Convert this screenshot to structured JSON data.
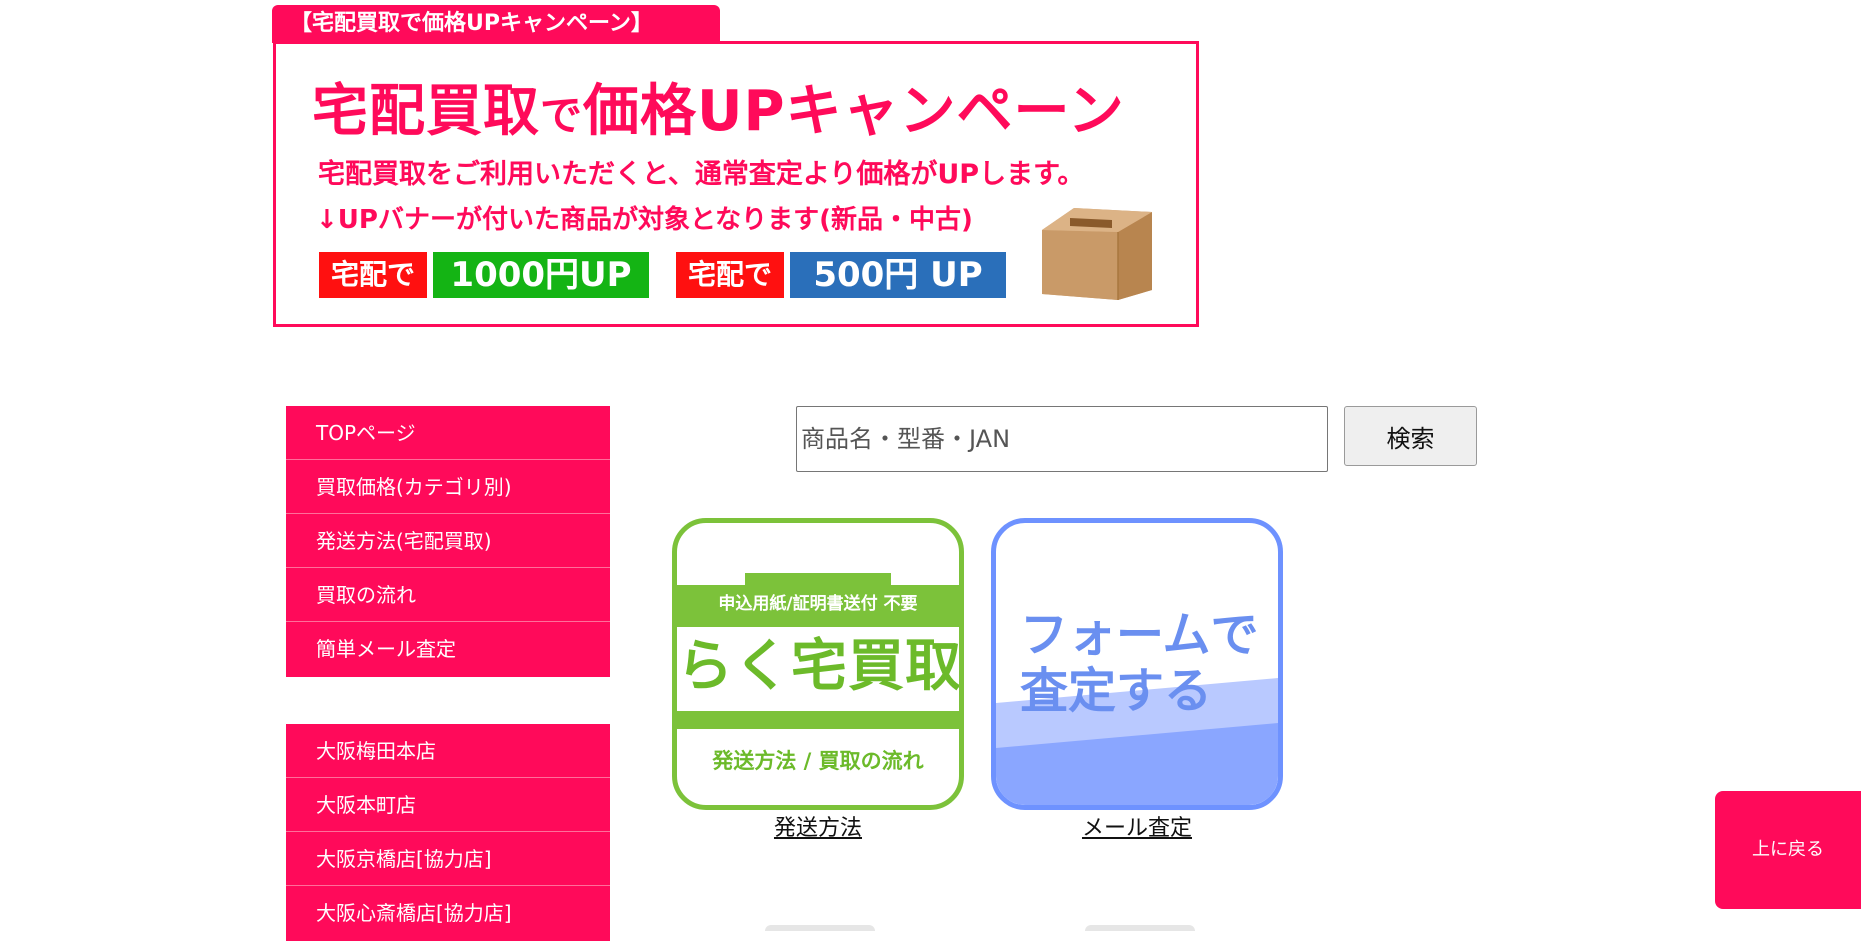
{
  "campaign": {
    "tab_label": "【宅配買取で価格UPキャンペーン】",
    "banner_title_a": "宅配買取",
    "banner_title_b": "で",
    "banner_title_c": "価格UPキャンペーン",
    "banner_line1": "宅配買取をご利用いただくと、通常査定より価格がUPします。",
    "banner_line2": "↓UPバナーが付いた商品が対象となります(新品・中古)",
    "tag_prefix": "宅配で",
    "tag_1000": "1000円UP",
    "tag_500": "500円 UP",
    "box_icon": "cardboard-box-icon",
    "accent_color": "#ff0a5a"
  },
  "sidebar": {
    "menu": [
      {
        "label": "TOPページ"
      },
      {
        "label": "買取価格(カテゴリ別)"
      },
      {
        "label": "発送方法(宅配買取)"
      },
      {
        "label": "買取の流れ"
      },
      {
        "label": "簡単メール査定"
      }
    ],
    "stores": [
      {
        "label": "大阪梅田本店"
      },
      {
        "label": "大阪本町店"
      },
      {
        "label": "大阪京橋店[協力店]"
      },
      {
        "label": "大阪心斎橋店[協力店]"
      }
    ]
  },
  "search": {
    "placeholder": "商品名・型番・JAN",
    "value": "",
    "button_label": "検索"
  },
  "tiles": {
    "shipping": {
      "header": "申込用紙/証明書送付 不要",
      "title": "らく宅買取",
      "footer": "発送方法 / 買取の流れ",
      "caption": "発送方法",
      "color": "#7cc23a"
    },
    "mail": {
      "line1": "フォームで",
      "line2": "査定する",
      "caption": "メール査定",
      "color": "#6e92ff"
    }
  },
  "back_to_top": {
    "label": "上に戻る"
  }
}
